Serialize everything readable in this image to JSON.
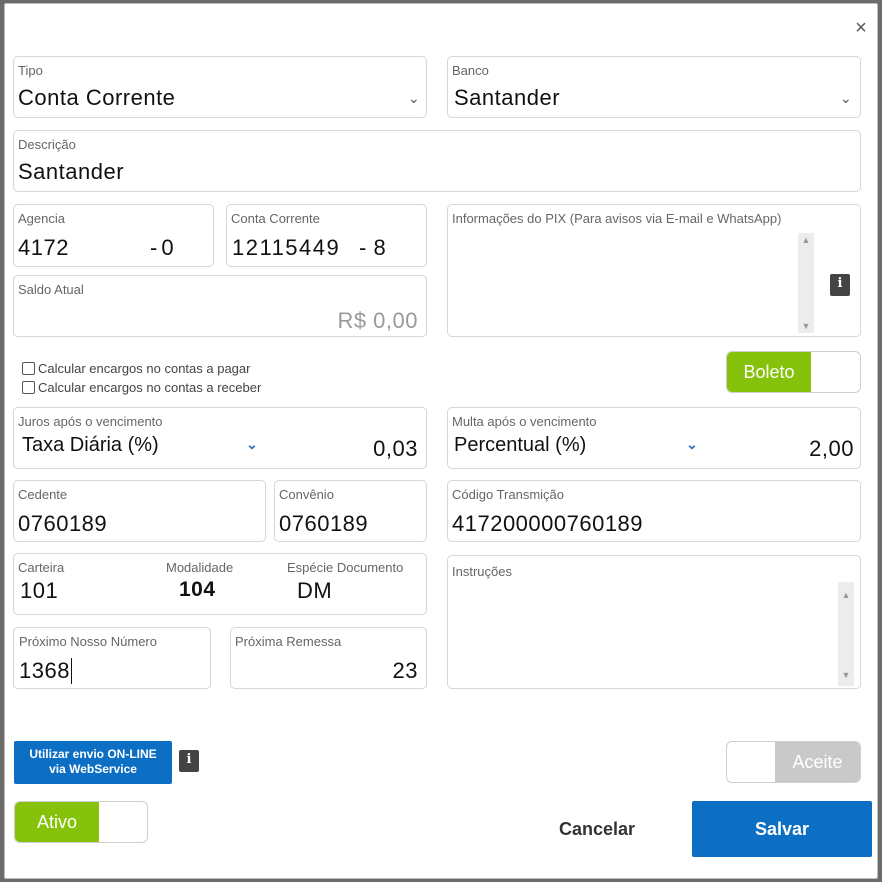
{
  "dialog": {
    "close_glyph": "×"
  },
  "tipo": {
    "label": "Tipo",
    "value": "Conta Corrente"
  },
  "banco": {
    "label": "Banco",
    "value": "Santander"
  },
  "descricao": {
    "label": "Descrição",
    "value": "Santander"
  },
  "agencia": {
    "label": "Agencia",
    "number": "4172",
    "digit": "-0"
  },
  "conta_corrente": {
    "label": "Conta Corrente",
    "number": "12115449",
    "digit": "- 8"
  },
  "saldo": {
    "label": "Saldo Atual",
    "value": "R$ 0,00"
  },
  "pix": {
    "label": "Informações do PIX (Para avisos via E-mail e WhatsApp)",
    "value": ""
  },
  "checkboxes": [
    {
      "label": "Calcular encargos no contas a pagar",
      "checked": false
    },
    {
      "label": "Calcular encargos no contas a receber",
      "checked": false
    }
  ],
  "boleto_toggle": {
    "label": "Boleto",
    "on": true,
    "on_color": "#86c20b"
  },
  "juros": {
    "label": "Juros após o vencimento",
    "type": "Taxa Diária (%)",
    "value": "0,03"
  },
  "multa": {
    "label": "Multa após o vencimento",
    "type": "Percentual (%)",
    "value": "2,00"
  },
  "cedente": {
    "label": "Cedente",
    "value": "0760189"
  },
  "convenio": {
    "label": "Convênio",
    "value": "0760189"
  },
  "codigo_transmissao": {
    "label": "Código Transmição",
    "value": "417200000760189"
  },
  "carteira": {
    "label": "Carteira",
    "value": "101"
  },
  "modalidade": {
    "label": "Modalidade",
    "value": "104"
  },
  "especie": {
    "label": "Espécie Documento",
    "value": "DM"
  },
  "instrucoes": {
    "label": "Instruções",
    "value": ""
  },
  "proximo_nosso_numero": {
    "label": "Próximo Nosso Número",
    "value": "1368"
  },
  "proxima_remessa": {
    "label": "Próxima Remessa",
    "value": "23"
  },
  "webservice_button": {
    "line1": "Utilizar envio ON-LINE",
    "line2": "via WebService"
  },
  "aceite_toggle": {
    "label": "Aceite",
    "on": false
  },
  "ativo_toggle": {
    "label": "Ativo",
    "on": true
  },
  "actions": {
    "cancel": "Cancelar",
    "save": "Salvar"
  },
  "colors": {
    "primary": "#0d6fc4",
    "toggle_on": "#86c20b",
    "toggle_off": "#c9c9c9"
  },
  "icons": {
    "info": "info-icon",
    "chevron": "chevron-down-icon"
  }
}
